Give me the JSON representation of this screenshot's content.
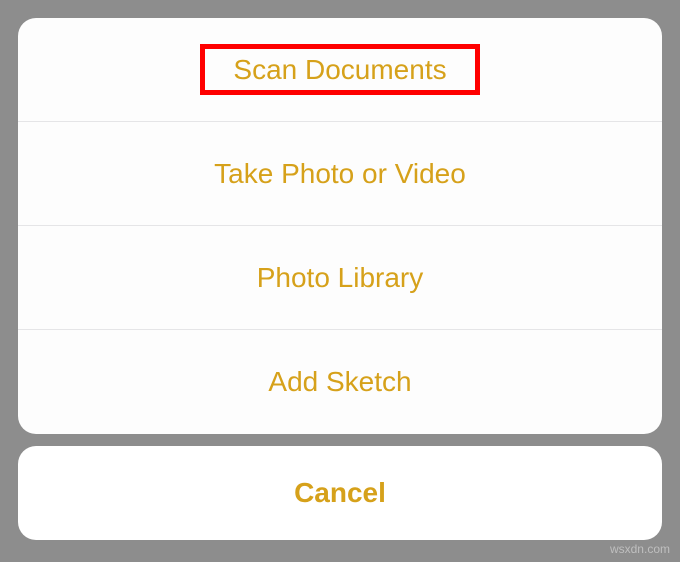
{
  "actionSheet": {
    "options": [
      {
        "label": "Scan Documents",
        "highlighted": true
      },
      {
        "label": "Take Photo or Video",
        "highlighted": false
      },
      {
        "label": "Photo Library",
        "highlighted": false
      },
      {
        "label": "Add Sketch",
        "highlighted": false
      }
    ],
    "cancel_label": "Cancel"
  },
  "colors": {
    "accent": "#d6a11a",
    "highlight_border": "#ff0000",
    "sheet_bg": "#fdfdfd",
    "page_bg": "#8d8d8d"
  },
  "watermark": "wsxdn.com"
}
